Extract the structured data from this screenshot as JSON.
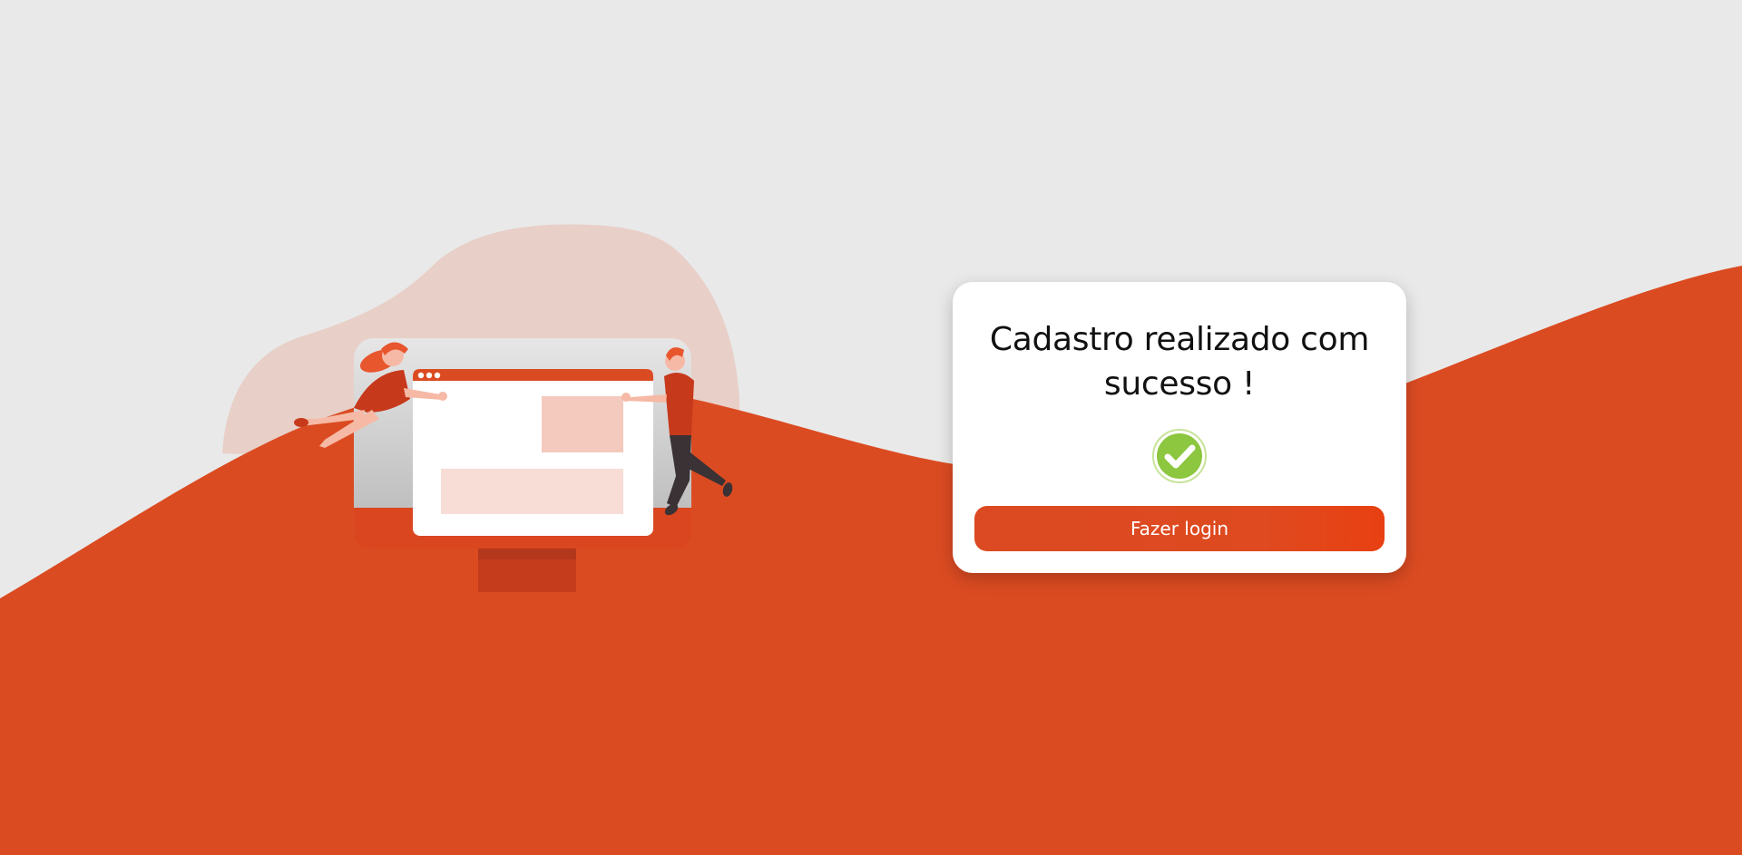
{
  "colors": {
    "background": "#e9e9e9",
    "accent": "#db4b22",
    "card": "#ffffff",
    "success": "#8dc63f"
  },
  "card": {
    "title": "Cadastro realizado com sucesso !",
    "icon": "check-circle-icon",
    "login_button": "Fazer login"
  },
  "illustration": {
    "icon": "people-with-monitor-illustration"
  }
}
